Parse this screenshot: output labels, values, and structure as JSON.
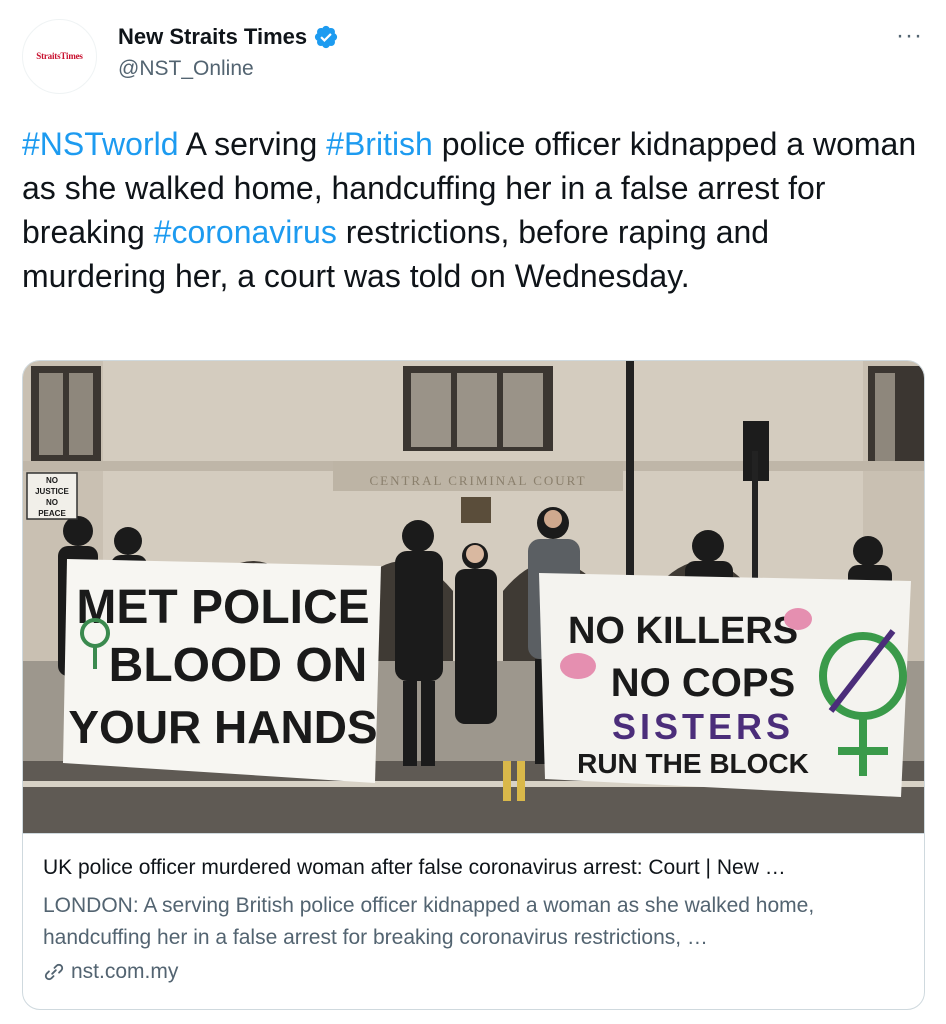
{
  "author": {
    "name": "New Straits Times",
    "handle": "@NST_Online",
    "avatar_text": "StraitsTimes",
    "verified_icon": "verified-badge-icon"
  },
  "more_label": "···",
  "tweet": {
    "segments": [
      {
        "text": "#NSTworld",
        "hashtag": true
      },
      {
        "text": " A serving ",
        "hashtag": false
      },
      {
        "text": "#British",
        "hashtag": true
      },
      {
        "text": " police officer kidnapped a woman as she walked home, handcuffing her in a false arrest for breaking ",
        "hashtag": false
      },
      {
        "text": "#coronavirus",
        "hashtag": true
      },
      {
        "text": " restrictions, before raping and murdering her, a court was told on Wednesday.",
        "hashtag": false
      }
    ]
  },
  "card": {
    "image": {
      "building_sign": "CENTRAL CRIMINAL COURT",
      "small_sign": [
        "NO",
        "JUSTICE",
        "NO",
        "PEACE"
      ],
      "banner_left": [
        "MET POLICE",
        "BLOOD ON",
        "YOUR HANDS"
      ],
      "banner_right": [
        "NO KILLERS",
        "NO COPS",
        "SISTERS",
        "RUN THE BLOCK"
      ]
    },
    "title": "UK police officer murdered woman after false coronavirus arrest: Court | New …",
    "description": "LONDON: A serving British police officer kidnapped a woman as she walked home, handcuffing her in a false arrest for breaking coronavirus restrictions, …",
    "domain": "nst.com.my"
  },
  "colors": {
    "accent": "#1d9bf0",
    "text": "#0f1419",
    "secondary": "#536471"
  }
}
